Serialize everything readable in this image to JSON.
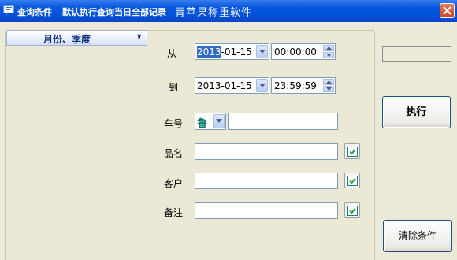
{
  "window": {
    "title": "查询条件",
    "subtitle": "默认执行查询当日全部记录",
    "app_name": "青苹果称重软件"
  },
  "nav": {
    "header_label": "月份、季度"
  },
  "form": {
    "from_label": "从",
    "from_date_selected": "2013",
    "from_date_rest": "-01-15",
    "from_time": "00:00:00",
    "to_label": "到",
    "to_date": "2013-01-15",
    "to_time": "23:59:59",
    "plate_label": "车号",
    "plate_prefix": "鲁",
    "plate_value": "",
    "product_label": "品名",
    "product_value": "",
    "customer_label": "客户",
    "customer_value": "",
    "note_label": "备注",
    "note_value": ""
  },
  "actions": {
    "status_text": "",
    "execute_label": "执行",
    "clear_label": "清除条件"
  },
  "colors": {
    "titlebar": "#0054e3",
    "accent_check": "#2e9e3a",
    "selection": "#316ac5"
  }
}
